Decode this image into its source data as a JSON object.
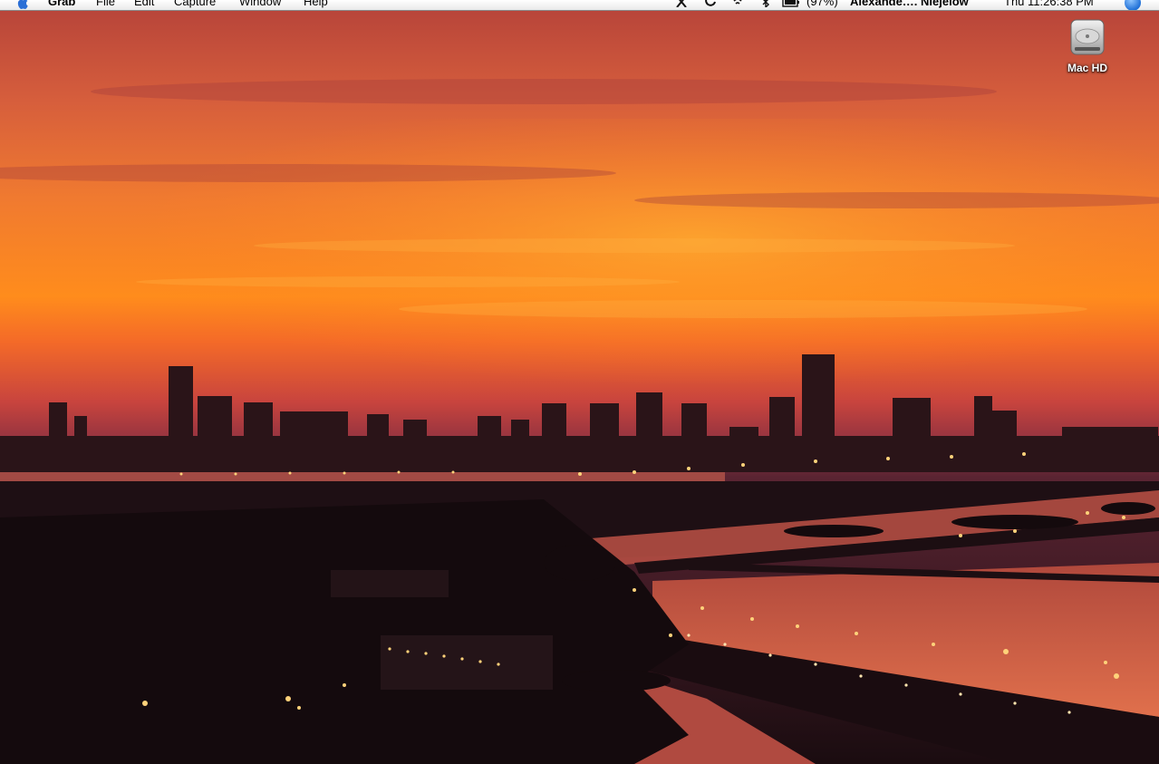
{
  "menubar": {
    "apple_icon": "apple-icon",
    "app_name": "Grab",
    "menus": [
      "File",
      "Edit",
      "Capture",
      "Window",
      "Help"
    ],
    "status": {
      "icons": [
        "close-x-icon",
        "time-machine-icon",
        "wifi-icon",
        "bluetooth-icon",
        "battery-icon"
      ],
      "battery_percent": "(97%)",
      "user_name": "Alexande…. Niejelow",
      "clock": "Thu 11:26:38 PM",
      "spotlight_icon": "spotlight-icon"
    }
  },
  "desktop": {
    "wallpaper": "city-skyline-sunset",
    "icons": [
      {
        "name": "Mac HD",
        "icon": "hard-drive-icon"
      }
    ]
  },
  "colors": {
    "sky_top": "#c04a3a",
    "sky_glow": "#ff8a20",
    "skyline": "#2a1418",
    "water": "#d05a40",
    "city_lights": "#ffd27a"
  }
}
